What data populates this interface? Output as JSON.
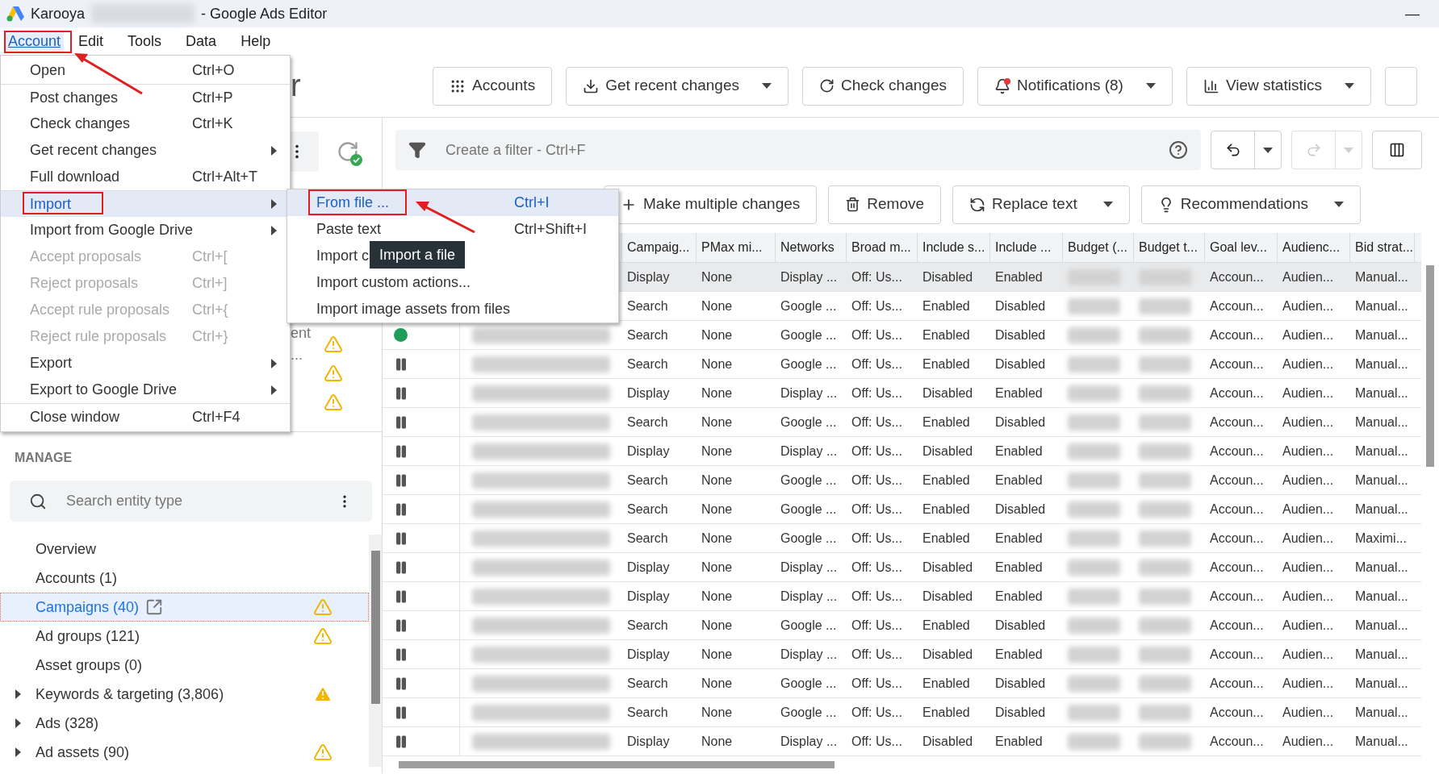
{
  "window": {
    "app": "Karooya",
    "title": "- Google Ads Editor",
    "minimize": "—"
  },
  "menu_bar": [
    {
      "label": "Account",
      "selected": true
    },
    {
      "label": "Edit",
      "selected": false
    },
    {
      "label": "Tools",
      "selected": false
    },
    {
      "label": "Data",
      "selected": false
    },
    {
      "label": "Help",
      "selected": false
    }
  ],
  "header": {
    "title": "r",
    "buttons": [
      {
        "label": "Accounts",
        "kind": "grid",
        "dropdown": false
      },
      {
        "label": "Get recent changes",
        "kind": "download",
        "dropdown": true
      },
      {
        "label": "Check changes",
        "kind": "refresh",
        "dropdown": false
      },
      {
        "label": "Notifications (8)",
        "kind": "bell",
        "dropdown": true
      },
      {
        "label": "View statistics",
        "kind": "chart",
        "dropdown": true
      }
    ]
  },
  "filter": {
    "placeholder": "Create a filter - Ctrl+F"
  },
  "actions": [
    {
      "label": "Make multiple changes",
      "kind": "plus",
      "dropdown": false
    },
    {
      "label": "Remove",
      "kind": "trash",
      "dropdown": false
    },
    {
      "label": "Replace text",
      "kind": "replace",
      "dropdown": true
    },
    {
      "label": "Recommendations",
      "kind": "bulb",
      "dropdown": true
    }
  ],
  "table": {
    "columns": [
      "Campaig...",
      "PMax mi...",
      "Networks",
      "Broad m...",
      "Include s...",
      "Include ...",
      "Budget (...",
      "Budget t...",
      "Goal lev...",
      "Audienc...",
      "Bid strat..."
    ],
    "rows": [
      {
        "selected": true,
        "cells": [
          "Display",
          "None",
          "Display ...",
          "Off: Us...",
          "Disabled",
          "Enabled",
          "",
          "",
          "Accoun...",
          "Audien...",
          "Manual..."
        ]
      },
      {
        "selected": false,
        "cells": [
          "Search",
          "None",
          "Google ...",
          "Off: Us...",
          "Enabled",
          "Disabled",
          "",
          "",
          "Accoun...",
          "Audien...",
          "Manual..."
        ]
      },
      {
        "selected": false,
        "kind": "enabled",
        "cells": [
          "Search",
          "None",
          "Google ...",
          "Off: Us...",
          "Enabled",
          "Disabled",
          "",
          "",
          "Accoun...",
          "Audien...",
          "Manual..."
        ]
      },
      {
        "selected": false,
        "kind": "paused",
        "cells": [
          "Search",
          "None",
          "Google ...",
          "Off: Us...",
          "Enabled",
          "Disabled",
          "",
          "",
          "Accoun...",
          "Audien...",
          "Manual..."
        ]
      },
      {
        "selected": false,
        "kind": "paused",
        "cells": [
          "Display",
          "None",
          "Display ...",
          "Off: Us...",
          "Disabled",
          "Enabled",
          "",
          "",
          "Accoun...",
          "Audien...",
          "Manual..."
        ]
      },
      {
        "selected": false,
        "kind": "paused",
        "cells": [
          "Search",
          "None",
          "Google ...",
          "Off: Us...",
          "Enabled",
          "Disabled",
          "",
          "",
          "Accoun...",
          "Audien...",
          "Manual..."
        ]
      },
      {
        "selected": false,
        "kind": "paused",
        "cells": [
          "Display",
          "None",
          "Display ...",
          "Off: Us...",
          "Disabled",
          "Enabled",
          "",
          "",
          "Accoun...",
          "Audien...",
          "Manual..."
        ]
      },
      {
        "selected": false,
        "kind": "paused",
        "cells": [
          "Search",
          "None",
          "Google ...",
          "Off: Us...",
          "Enabled",
          "Enabled",
          "",
          "",
          "Accoun...",
          "Audien...",
          "Manual..."
        ]
      },
      {
        "selected": false,
        "kind": "paused",
        "cells": [
          "Search",
          "None",
          "Google ...",
          "Off: Us...",
          "Enabled",
          "Disabled",
          "",
          "",
          "Accoun...",
          "Audien...",
          "Manual..."
        ]
      },
      {
        "selected": false,
        "kind": "paused",
        "cells": [
          "Search",
          "None",
          "Google ...",
          "Off: Us...",
          "Enabled",
          "Enabled",
          "",
          "",
          "Accoun...",
          "Audien...",
          "Maximi..."
        ]
      },
      {
        "selected": false,
        "kind": "paused",
        "cells": [
          "Display",
          "None",
          "Display ...",
          "Off: Us...",
          "Disabled",
          "Enabled",
          "",
          "",
          "Accoun...",
          "Audien...",
          "Manual..."
        ]
      },
      {
        "selected": false,
        "kind": "paused",
        "cells": [
          "Display",
          "None",
          "Display ...",
          "Off: Us...",
          "Disabled",
          "Enabled",
          "",
          "",
          "Accoun...",
          "Audien...",
          "Manual..."
        ]
      },
      {
        "selected": false,
        "kind": "paused",
        "cells": [
          "Search",
          "None",
          "Google ...",
          "Off: Us...",
          "Enabled",
          "Disabled",
          "",
          "",
          "Accoun...",
          "Audien...",
          "Manual..."
        ]
      },
      {
        "selected": false,
        "kind": "paused",
        "cells": [
          "Display",
          "None",
          "Display ...",
          "Off: Us...",
          "Disabled",
          "Enabled",
          "",
          "",
          "Accoun...",
          "Audien...",
          "Manual..."
        ]
      },
      {
        "selected": false,
        "kind": "paused",
        "cells": [
          "Search",
          "None",
          "Google ...",
          "Off: Us...",
          "Enabled",
          "Disabled",
          "",
          "",
          "Accoun...",
          "Audien...",
          "Manual..."
        ]
      },
      {
        "selected": false,
        "kind": "paused",
        "cells": [
          "Search",
          "None",
          "Google ...",
          "Off: Us...",
          "Enabled",
          "Disabled",
          "",
          "",
          "Accoun...",
          "Audien...",
          "Manual..."
        ]
      },
      {
        "selected": false,
        "kind": "paused",
        "cells": [
          "Display",
          "None",
          "Display ...",
          "Off: Us...",
          "Disabled",
          "Enabled",
          "",
          "",
          "Accoun...",
          "Audien...",
          "Manual..."
        ]
      }
    ]
  },
  "sidebar": {
    "upper_rows": [
      {
        "text": "ent ...",
        "kind": "outline"
      },
      {
        "kind": "outline"
      },
      {
        "kind": "outline"
      }
    ],
    "section": "MANAGE",
    "search": {
      "placeholder": "Search entity type"
    },
    "items": [
      {
        "label": "Overview",
        "selected": false,
        "expandable": false,
        "kind": "none"
      },
      {
        "label": "Accounts (1)",
        "selected": false,
        "expandable": false,
        "kind": "none"
      },
      {
        "label": "Campaigns (40)",
        "selected": true,
        "expandable": false,
        "kind": "outline"
      },
      {
        "label": "Ad groups (121)",
        "selected": false,
        "expandable": false,
        "kind": "outline"
      },
      {
        "label": "Asset groups (0)",
        "selected": false,
        "expandable": false,
        "kind": "none"
      },
      {
        "label": "Keywords & targeting (3,806)",
        "selected": false,
        "expandable": true,
        "kind": "filled"
      },
      {
        "label": "Ads (328)",
        "selected": false,
        "expandable": true,
        "kind": "none"
      },
      {
        "label": "Ad assets (90)",
        "selected": false,
        "expandable": true,
        "kind": "outline"
      }
    ]
  },
  "menu": {
    "items": [
      {
        "label": "Open",
        "shortcut": "Ctrl+O",
        "submenu": false,
        "disabled": false,
        "selected": false,
        "divider_before": false
      },
      {
        "label": "Post changes",
        "shortcut": "Ctrl+P",
        "submenu": false,
        "disabled": false,
        "selected": false,
        "divider_before": true
      },
      {
        "label": "Check changes",
        "shortcut": "Ctrl+K",
        "submenu": false,
        "disabled": false,
        "selected": false,
        "divider_before": false
      },
      {
        "label": "Get recent changes",
        "submenu": true,
        "disabled": false,
        "selected": false,
        "divider_before": false
      },
      {
        "label": "Full download",
        "shortcut": "Ctrl+Alt+T",
        "submenu": false,
        "disabled": false,
        "selected": false,
        "divider_before": false
      },
      {
        "label": "Import",
        "submenu": true,
        "disabled": false,
        "selected": true,
        "divider_before": true
      },
      {
        "label": "Import from Google Drive",
        "submenu": true,
        "disabled": false,
        "selected": false,
        "divider_before": false
      },
      {
        "label": "Accept proposals",
        "shortcut": "Ctrl+[",
        "submenu": false,
        "disabled": true,
        "selected": false,
        "divider_before": false
      },
      {
        "label": "Reject proposals",
        "shortcut": "Ctrl+]",
        "submenu": false,
        "disabled": true,
        "selected": false,
        "divider_before": false
      },
      {
        "label": "Accept rule proposals",
        "shortcut": "Ctrl+{",
        "submenu": false,
        "disabled": true,
        "selected": false,
        "divider_before": false
      },
      {
        "label": "Reject rule proposals",
        "shortcut": "Ctrl+}",
        "submenu": false,
        "disabled": true,
        "selected": false,
        "divider_before": false
      },
      {
        "label": "Export",
        "submenu": true,
        "disabled": false,
        "selected": false,
        "divider_before": false
      },
      {
        "label": "Export to Google Drive",
        "submenu": true,
        "disabled": false,
        "selected": false,
        "divider_before": false
      },
      {
        "label": "Close window",
        "shortcut": "Ctrl+F4",
        "submenu": false,
        "disabled": false,
        "selected": false,
        "divider_before": true
      }
    ]
  },
  "submenu": {
    "items": [
      {
        "label": "From file ...",
        "shortcut": "Ctrl+I",
        "selected": true
      },
      {
        "label": "Paste text",
        "shortcut": "Ctrl+Shift+I",
        "selected": false
      },
      {
        "label": "Import c",
        "selected": false
      },
      {
        "label": "Import custom actions...",
        "selected": false
      },
      {
        "label": "Import image assets from files",
        "selected": false
      }
    ]
  },
  "tooltip": "Import a file"
}
